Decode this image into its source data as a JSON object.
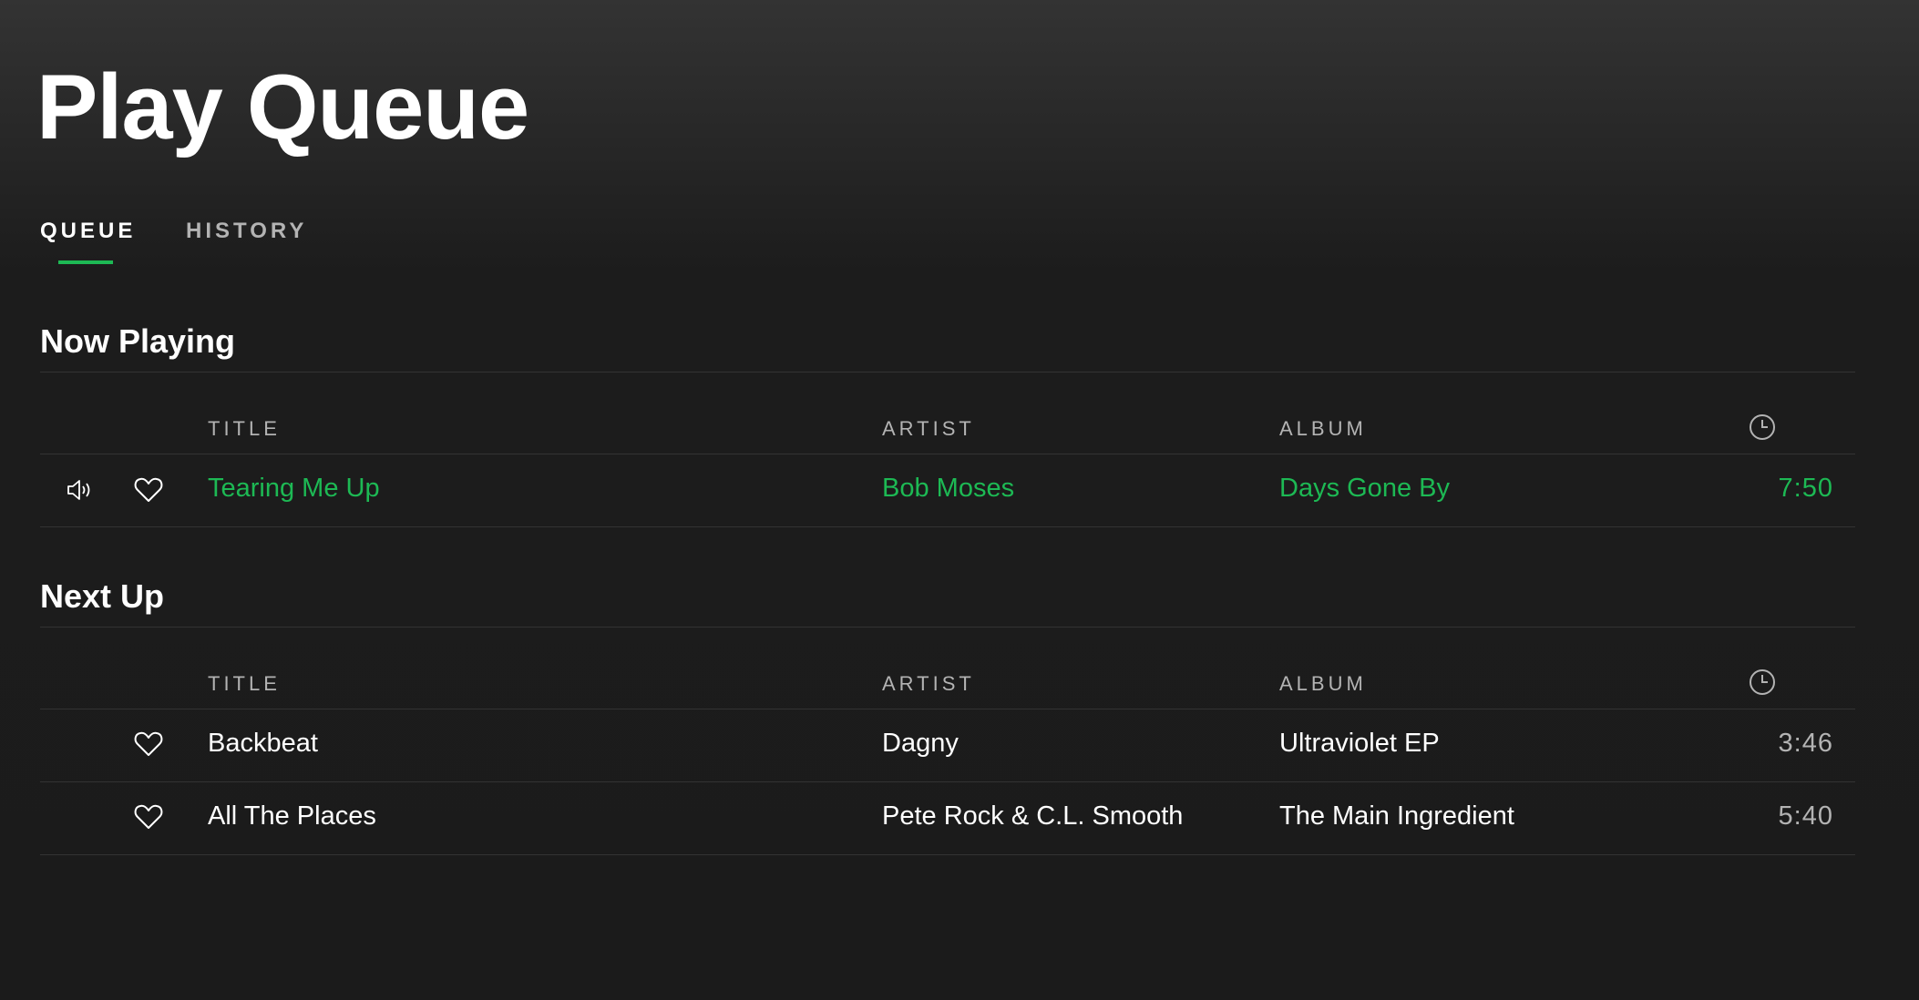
{
  "page": {
    "title": "Play Queue"
  },
  "tabs": [
    {
      "label": "QUEUE",
      "active": true
    },
    {
      "label": "HISTORY",
      "active": false
    }
  ],
  "now_playing": {
    "heading": "Now Playing",
    "columns": {
      "title": "TITLE",
      "artist": "ARTIST",
      "album": "ALBUM",
      "duration_icon": "clock-icon"
    },
    "tracks": [
      {
        "title": "Tearing Me Up",
        "artist": "Bob Moses",
        "album": "Days Gone By",
        "duration": "7:50",
        "playing": true
      }
    ]
  },
  "next_up": {
    "heading": "Next Up",
    "columns": {
      "title": "TITLE",
      "artist": "ARTIST",
      "album": "ALBUM",
      "duration_icon": "clock-icon"
    },
    "tracks": [
      {
        "title": "Backbeat",
        "artist": "Dagny",
        "album": "Ultraviolet EP",
        "duration": "3:46"
      },
      {
        "title": "All The Places",
        "artist": "Pete Rock & C.L. Smooth",
        "album": "The Main Ingredient",
        "duration": "5:40"
      }
    ]
  },
  "colors": {
    "accent": "#1db954",
    "background": "#1b1b1b",
    "text": "#ffffff",
    "muted": "#b3b3b3",
    "divider": "#333333"
  }
}
